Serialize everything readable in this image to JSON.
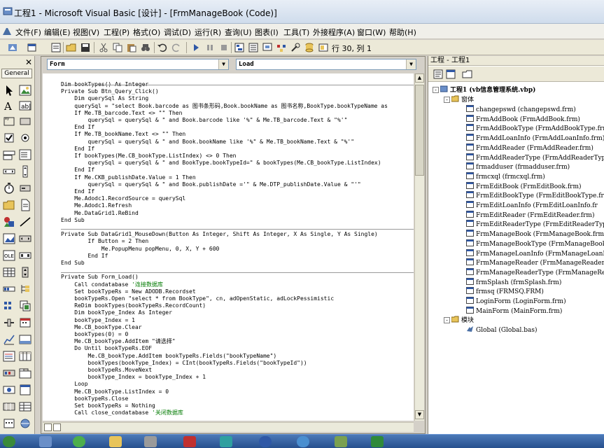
{
  "window": {
    "title": "工程1 - Microsoft Visual Basic [设计] - [FrmManageBook (Code)]"
  },
  "menu": {
    "items": [
      {
        "label": "文件(F)"
      },
      {
        "label": "编辑(E)"
      },
      {
        "label": "视图(V)"
      },
      {
        "label": "工程(P)"
      },
      {
        "label": "格式(O)"
      },
      {
        "label": "调试(D)"
      },
      {
        "label": "运行(R)"
      },
      {
        "label": "查询(U)"
      },
      {
        "label": "图表(I)"
      },
      {
        "label": "工具(T)"
      },
      {
        "label": "外接程序(A)"
      },
      {
        "label": "窗口(W)"
      },
      {
        "label": "帮助(H)"
      }
    ]
  },
  "toolbar": {
    "cursor_position": "行 30, 列 1"
  },
  "toolbox": {
    "tab_label": "General",
    "close_glyph": "✕"
  },
  "code_window": {
    "object_combo": "Form",
    "procedure_combo": "Load",
    "lines": [
      "Dim bookTypes() As Integer",
      "Private Sub Btn_Query_Click()",
      "    Dim querySql As String",
      "    querySql = \"select Book.barcode as 图书条形码,Book.bookName as 图书名称,BookType.bookTypeName as",
      "    If Me.TB_barcode.Text <> \"\" Then",
      "        querySql = querySql & \" and Book.barcode like '%\" & Me.TB_barcode.Text & \"%'\"",
      "    End If",
      "    If Me.TB_bookName.Text <> \"\" Then",
      "        querySql = querySql & \" and Book.bookName like '%\" & Me.TB_bookName.Text & \"%'\"",
      "    End If",
      "    If bookTypes(Me.CB_bookType.ListIndex) <> 0 Then",
      "        querySql = querySql & \" and BookType.bookTypeId=\" & bookTypes(Me.CB_bookType.ListIndex)",
      "    End If",
      "    If Me.CKB_publishDate.Value = 1 Then",
      "        querySql = querySql & \" and Book.publishDate ='\" & Me.DTP_publishDate.Value & \"'\"",
      "    End If",
      "    Me.Adodc1.RecordSource = querySql",
      "    Me.Adodc1.Refresh",
      "    Me.DataGrid1.ReBind",
      "End Sub",
      "",
      "Private Sub DataGrid1_MouseDown(Button As Integer, Shift As Integer, X As Single, Y As Single)",
      "        If Button = 2 Then",
      "            Me.PopupMenu popMenu, 0, X, Y + 600",
      "        End If",
      "End Sub",
      "",
      "Private Sub Form_Load()",
      "    Call condatabase",
      "    Set bookTypeRs = New ADODB.Recordset",
      "    bookTypeRs.Open \"select * from BookType\", cn, adOpenStatic, adLockPessimistic",
      "    ReDim bookTypes(bookTypeRs.RecordCount)",
      "    Dim bookType_Index As Integer",
      "    bookType_Index = 1",
      "    Me.CB_bookType.Clear",
      "    bookTypes(0) = 0",
      "    Me.CB_bookType.AddItem \"请选择\"",
      "    Do Until bookTypeRs.EOF",
      "        Me.CB_bookType.AddItem bookTypeRs.Fields(\"bookTypeName\")",
      "        bookTypes(bookType_Index) = CInt(bookTypeRs.Fields(\"bookTypeId\"))",
      "        bookTypeRs.MoveNext",
      "        bookType_Index = bookType_Index + 1",
      "    Loop",
      "    Me.CB_bookType.ListIndex = 0",
      "    bookTypeRs.Close",
      "    Set bookTypeRs = Nothing",
      "    Call close_condatabase"
    ],
    "comments": {
      "28": "'连接数据库",
      "46": "'关闭数据库"
    }
  },
  "project": {
    "panel_title": "工程 - 工程1",
    "root_label": "工程1 (vb信息管理系统.vbp)",
    "forms_folder": "窗体",
    "forms": [
      "changepswd (changepswd.frm)",
      "FrmAddBook (FrmAddBook.frm)",
      "FrmAddBookType (FrmAddBookType.frm)",
      "FrmAddLoanInfo (FrmAddLoanInfo.frm)",
      "FrmAddReader (FrmAddReader.frm)",
      "FrmAddReaderType (FrmAddReaderType.",
      "frmadduser (frmadduser.frm)",
      "frmcxql (frmcxql.frm)",
      "FrmEditBook (FrmEditBook.frm)",
      "FrmEditBookType (FrmEditBookType.fr",
      "FrmEditLoanInfo (FrmEditLoanInfo.fr",
      "FrmEditReader (FrmEditReader.frm)",
      "FrmEditReaderType (FrmEditReaderTyp",
      "FrmManageBook (FrmManageBook.frm)",
      "FrmManageBookType (FrmManageBookTyp",
      "FrmManageLoanInfo (FrmManageLoanInf",
      "FrmManageReader (FrmManageReader.fr",
      "FrmManageReaderType (FrmManageReade",
      "frmSplash (frmSplash.frm)",
      "frmsq (FRMSQ.FRM)",
      "LoginForm (LoginForm.frm)",
      "MainForm (MainForm.frm)"
    ],
    "modules_folder": "模块",
    "modules": [
      "Global (Global.bas)"
    ]
  },
  "colors": {
    "comment": "#007a00",
    "folder": "#e8c45a",
    "taskbar": "#27508e"
  }
}
